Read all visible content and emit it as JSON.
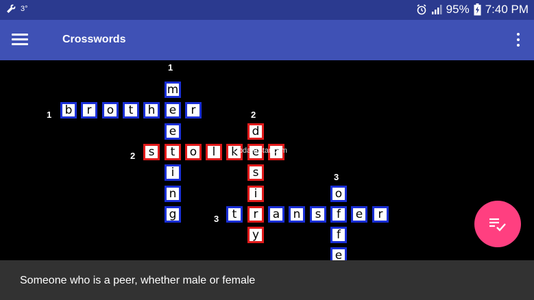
{
  "status_bar": {
    "notification_text": "3°",
    "battery_percent": "95%",
    "time": "7:40 PM"
  },
  "app_bar": {
    "title": "Crosswords"
  },
  "watermark": "UpdateStar.com",
  "clue": "Someone who is a peer, whether male or female",
  "colors": {
    "status_bar": "#2b3a8f",
    "app_bar": "#3f51b5",
    "cell_border": "#1a2fd6",
    "active_border": "#e11b1b",
    "fab": "#ff3f80",
    "clue_bar": "#323232"
  },
  "numbers": {
    "down_1": "1",
    "across_1": "1",
    "down_2": "2",
    "across_2": "2",
    "down_3": "3",
    "across_3": "3"
  },
  "words": {
    "across_1": [
      "b",
      "r",
      "o",
      "t",
      "h",
      "e",
      "r"
    ],
    "across_2": [
      "s",
      "t",
      "o",
      "l",
      "k",
      "e",
      "r"
    ],
    "across_3": [
      "t",
      "r",
      "a",
      "n",
      "s",
      "f",
      "e",
      "r"
    ],
    "down_1": [
      "m",
      "e",
      "e",
      "t",
      "i",
      "n",
      "g"
    ],
    "down_2": [
      "d",
      "e",
      "s",
      "i",
      "r",
      "y"
    ],
    "down_3": [
      "o",
      "f",
      "f",
      "e"
    ]
  }
}
